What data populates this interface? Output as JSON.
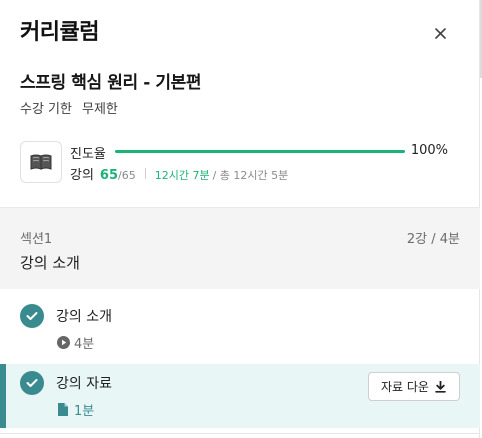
{
  "header": {
    "title": "커리큘럼"
  },
  "course": {
    "title": "스프링 핵심 원리 - 기본편",
    "period_label": "수강 기한",
    "period_value": "무제한"
  },
  "progress": {
    "label": "진도율",
    "percent_text": "100%",
    "fraction": 1.0,
    "lecture_label": "강의",
    "lectures_done": "65",
    "lectures_total": "/65",
    "time_done": "12시간 7분",
    "time_total": "/ 총 12시간 5분"
  },
  "section": {
    "name": "섹션1",
    "meta": "2강 / 4분",
    "title": "강의 소개"
  },
  "lessons": [
    {
      "title": "강의 소개",
      "duration": "4분",
      "type_icon": "play-icon"
    },
    {
      "title": "강의 자료",
      "duration": "1분",
      "type_icon": "document-icon",
      "download_label": "자료 다운"
    }
  ],
  "colors": {
    "accent": "#3a8b8f",
    "progress": "#1bb376",
    "section_bg": "#f4f4f5",
    "active_bg": "#e8f6f6"
  }
}
